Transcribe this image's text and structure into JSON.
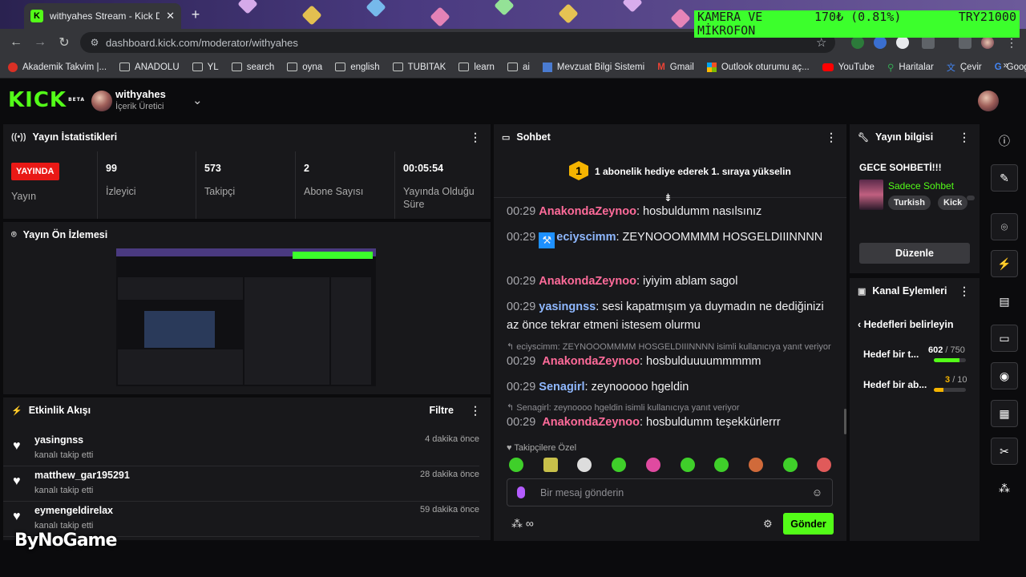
{
  "browser": {
    "tab_title": "withyahes Stream - Kick Dashbo",
    "url": "dashboard.kick.com/moderator/withyahes",
    "bookmarks": [
      "Akademik Takvim |...",
      "ANADOLU",
      "YL",
      "search",
      "oyna",
      "english",
      "TUBITAK",
      "learn",
      "ai",
      "Mevzuat Bilgi Sistemi",
      "Gmail",
      "Outlook oturumu aç...",
      "YouTube",
      "Haritalar",
      "Çevir",
      "Google"
    ]
  },
  "overlay": {
    "line1": "KAMERA VE",
    "line2": "170₺ (0.81%)",
    "line3": "TRY21000",
    "line4": "MİKROFON"
  },
  "header": {
    "logo": "KICK",
    "beta": "BETA",
    "channel": "withyahes",
    "role": "İçerik Üretici"
  },
  "stats": {
    "title": "Yayın İstatistikleri",
    "live_badge": "YAYINDA",
    "items": [
      {
        "value": "",
        "label": "Yayın"
      },
      {
        "value": "99",
        "label": "İzleyici"
      },
      {
        "value": "573",
        "label": "Takipçi"
      },
      {
        "value": "2",
        "label": "Abone Sayısı"
      },
      {
        "value": "00:05:54",
        "label": "Yayında Olduğu Süre"
      }
    ]
  },
  "preview": {
    "title": "Yayın Ön İzlemesi"
  },
  "activity": {
    "title": "Etkinlik Akışı",
    "filter": "Filtre",
    "items": [
      {
        "name": "yasingnss",
        "sub": "kanalı takip etti",
        "time": "4 dakika önce"
      },
      {
        "name": "matthew_gar195291",
        "sub": "kanalı takip etti",
        "time": "28 dakika önce"
      },
      {
        "name": "eymengeldirelax",
        "sub": "kanalı takip etti",
        "time": "59 dakika önce"
      }
    ]
  },
  "watermark": "ByNoGame",
  "chat": {
    "title": "Sohbet",
    "pinned_rank": "1",
    "pinned_text": "1 abonelik hediye ederek 1. sıraya yükselin",
    "messages": [
      {
        "time": "00:29",
        "user": "AnakondaZeynoo",
        "color": "#ff6b9a",
        "text": "hosbuldumm nasılsınız"
      },
      {
        "time": "00:29",
        "user": "eciyscimm",
        "color": "#8fb8ff",
        "text": "ZEYNOOOMMMM HOSGELDIIINNNN"
      },
      {
        "time": "00:29",
        "user": "AnakondaZeynoo",
        "color": "#ff6b9a",
        "text": "iyiyim ablam sagol"
      },
      {
        "time": "00:29",
        "user": "yasingnss",
        "color": "#8fb8ff",
        "text": "sesi kapatmışım ya duymadın ne dediğinizi az önce tekrar etmeni istesem olurmu"
      },
      {
        "time": "00:29",
        "user": "AnakondaZeynoo",
        "color": "#ff6b9a",
        "text": "hosbulduuuummmmm"
      },
      {
        "time": "00:29",
        "user": "Senagirl",
        "color": "#8fb8ff",
        "text": "zeynooooo hgeldin"
      },
      {
        "time": "00:29",
        "user": "AnakondaZeynoo",
        "color": "#ff6b9a",
        "text": "hosbuldumm teşekkürlerrr"
      }
    ],
    "replies": [
      "eciyscimm: ZEYNOOOMMMM HOSGELDIIINNNN isimli kullanıcıya yanıt veriyor",
      "Senagirl: zeynoooo hgeldin isimli kullanıcıya yanıt veriyor"
    ],
    "followers_only": "Takipçilere Özel",
    "input_placeholder": "Bir mesaj gönderin",
    "send": "Gönder"
  },
  "stream_info": {
    "title": "Yayın bilgisi",
    "stream_title": "GECE SOHBETİ!!!",
    "category": "Sadece Sohbet",
    "tags": [
      "Turkish",
      "Kick"
    ],
    "edit": "Düzenle"
  },
  "channel_actions": {
    "title": "Kanal Eylemleri",
    "back": "Hedefleri belirleyin",
    "goals": [
      {
        "label": "Hedef bir t...",
        "current": "602",
        "target": "/ 750",
        "progress": 0.803,
        "color": "#53fc18"
      },
      {
        "label": "Hedef bir ab...",
        "current": "3",
        "target": "/ 10",
        "progress": 0.3,
        "color": "#f5b400"
      }
    ]
  },
  "colors": {
    "accent": "#53fc18",
    "live": "#e91916",
    "panel": "#18181b",
    "bg": "#0b0b0d"
  }
}
